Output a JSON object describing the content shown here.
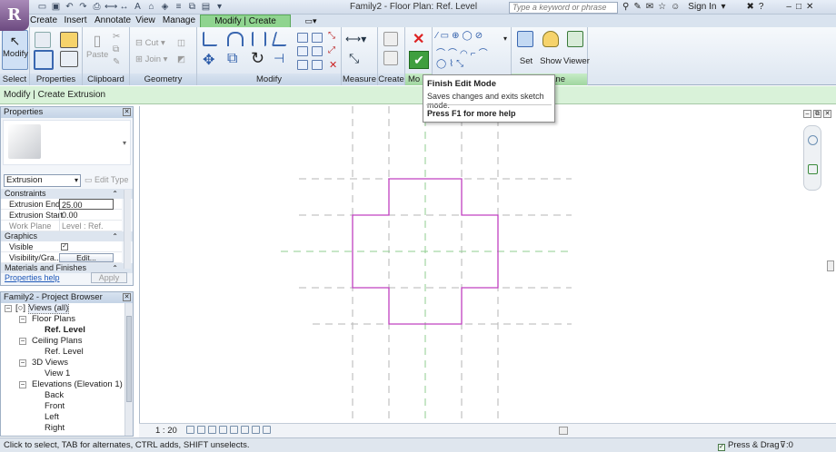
{
  "window": {
    "title": "Family2 - Floor Plan: Ref. Level",
    "search_placeholder": "Type a keyword or phrase",
    "sign_in": "Sign In"
  },
  "tabs": [
    "Create",
    "Insert",
    "Annotate",
    "View",
    "Manage",
    "Modify | Create Extrusion"
  ],
  "ribbon": {
    "select": {
      "label": "Select",
      "modify": "Modify"
    },
    "properties": {
      "label": "Properties"
    },
    "clipboard": {
      "label": "Clipboard",
      "paste": "Paste",
      "cut": "Cut",
      "join": "Join"
    },
    "geometry": {
      "label": "Geometry"
    },
    "modify": {
      "label": "Modify"
    },
    "measure": {
      "label": "Measure"
    },
    "create": {
      "label": "Create"
    },
    "mode": {
      "label": "Mo"
    },
    "workplane": {
      "label": "Plane",
      "set": "Set",
      "show": "Show",
      "viewer": "Viewer"
    }
  },
  "options_bar": {
    "text": "Modify | Create Extrusion"
  },
  "tooltip": {
    "title": "Finish Edit Mode",
    "description": "Saves changes and exits sketch mode.",
    "help": "Press F1 for more help"
  },
  "properties": {
    "title": "Properties",
    "type": "Extrusion",
    "edit_type": "Edit Type",
    "sections": {
      "constraints": "Constraints",
      "graphics": "Graphics",
      "materials": "Materials and Finishes"
    },
    "rows": {
      "extrusion_end": {
        "label": "Extrusion End",
        "value": "25.00"
      },
      "extrusion_start": {
        "label": "Extrusion Start",
        "value": "0.00"
      },
      "work_plane": {
        "label": "Work Plane",
        "value": "Level : Ref. Le..."
      },
      "visible": {
        "label": "Visible",
        "checked": true
      },
      "visibility": {
        "label": "Visibility/Gra...",
        "button": "Edit..."
      }
    },
    "help_link": "Properties help",
    "apply": "Apply"
  },
  "browser": {
    "title": "Family2 - Project Browser",
    "nodes": {
      "views_all": "Views (all)",
      "floor_plans": "Floor Plans",
      "ref_level": "Ref. Level",
      "ceiling_plans": "Ceiling Plans",
      "ceiling_ref_level": "Ref. Level",
      "views_3d": "3D Views",
      "view1": "View 1",
      "elevations": "Elevations (Elevation 1)",
      "back": "Back",
      "front": "Front",
      "left": "Left",
      "right": "Right"
    }
  },
  "view_control": {
    "scale": "1 : 20"
  },
  "status": {
    "message": "Click to select, TAB for alternates, CTRL adds, SHIFT unselects.",
    "press_drag": "Press & Drag",
    "filter": ":0"
  },
  "colors": {
    "sketch": "#c040c0",
    "ref_plane": "#8fce8f",
    "accent": "#8fd48f"
  }
}
